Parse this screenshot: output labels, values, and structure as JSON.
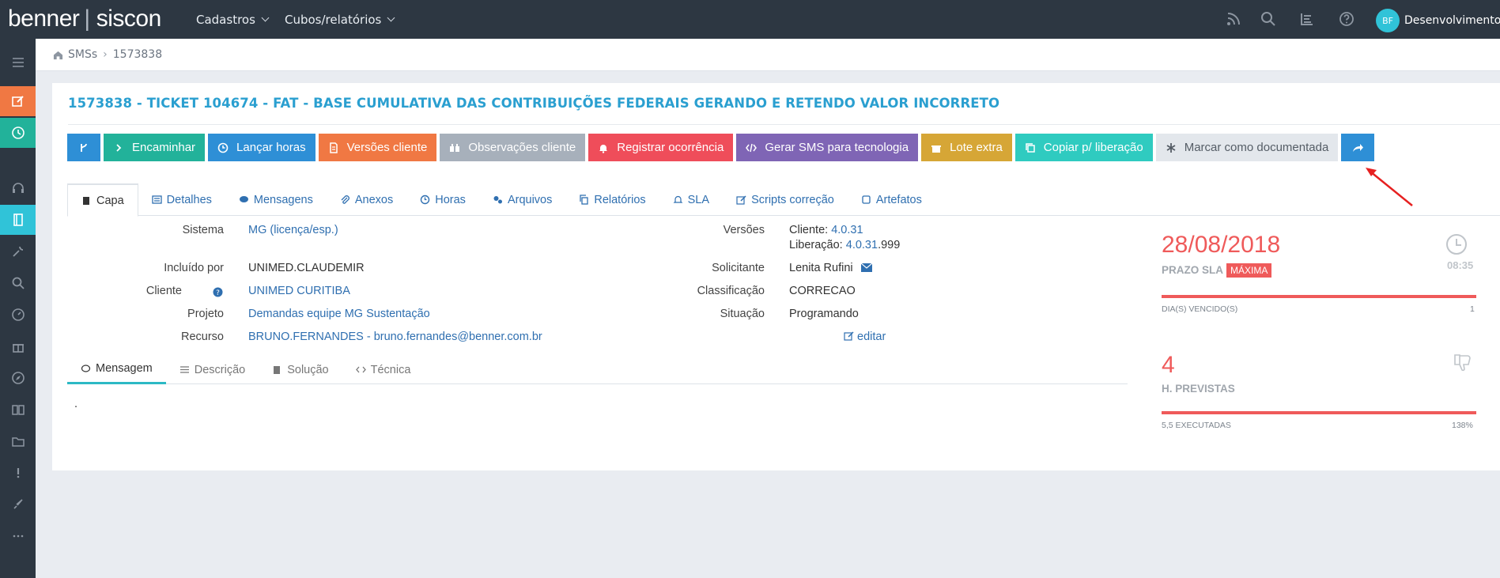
{
  "app": {
    "brand": "benner",
    "product": "siscon"
  },
  "topnav": [
    {
      "label": "Cadastros"
    },
    {
      "label": "Cubos/relatórios"
    }
  ],
  "user": {
    "initials": "BF",
    "name": "Desenvolvimento"
  },
  "breadcrumb": {
    "parent": "SMSs",
    "current": "1573838"
  },
  "title": "1573838 - TICKET 104674 - FAT - BASE CUMULATIVA DAS CONTRIBUIÇÕES FEDERAIS GERANDO E RETENDO VALOR INCORRETO",
  "toolbar": {
    "encaminhar": "Encaminhar",
    "lancar_horas": "Lançar horas",
    "versoes_cliente": "Versões cliente",
    "observacoes_cliente": "Observações cliente",
    "registrar_ocorrencia": "Registrar ocorrência",
    "gerar_sms": "Gerar SMS para tecnologia",
    "lote_extra": "Lote extra",
    "copiar_liberacao": "Copiar p/ liberação",
    "marcar_documentada": "Marcar como documentada"
  },
  "tabs": [
    "Capa",
    "Detalhes",
    "Mensagens",
    "Anexos",
    "Horas",
    "Arquivos",
    "Relatórios",
    "SLA",
    "Scripts correção",
    "Artefatos"
  ],
  "fields": {
    "sistema_label": "Sistema",
    "sistema_value": "MG",
    "sistema_link": "licença/esp.",
    "incluido_label": "Incluído por",
    "incluido_value": "UNIMED.CLAUDEMIR",
    "cliente_label": "Cliente",
    "cliente_value": "UNIMED CURITIBA",
    "projeto_label": "Projeto",
    "projeto_value": "Demandas equipe MG Sustentação",
    "recurso_label": "Recurso",
    "recurso_value": "BRUNO.FERNANDES - bruno.fernandes@benner.com.br",
    "versoes_label": "Versões",
    "cliente_ver_prefix": "Cliente:",
    "cliente_ver": "4.0.31",
    "liberacao_prefix": "Liberação:",
    "liberacao_ver": "4.0.31",
    "liberacao_suffix": ".999",
    "solicitante_label": "Solicitante",
    "solicitante_value": "Lenita Rufini",
    "classificacao_label": "Classificação",
    "classificacao_value": "CORRECAO",
    "situacao_label": "Situação",
    "situacao_value": "Programando",
    "editar": "editar"
  },
  "subtabs": [
    "Mensagem",
    "Descrição",
    "Solução",
    "Técnica"
  ],
  "message_body": ".",
  "sla": {
    "date": "28/08/2018",
    "label": "PRAZO SLA",
    "badge": "MÁXIMA",
    "time": "08:35",
    "overdue_label": "DIA(S) VENCIDO(S)",
    "overdue_count": "1",
    "hours": "4",
    "hours_label": "H. PREVISTAS",
    "executed_label": "5,5 EXECUTADAS",
    "executed_pct": "138%",
    "overdue_fill": 1.0,
    "executed_fill": 1.0
  },
  "colors": {
    "accent": "#2a9fd0",
    "sla_red": "#ef5a5a",
    "topbar": "#2d3742"
  }
}
